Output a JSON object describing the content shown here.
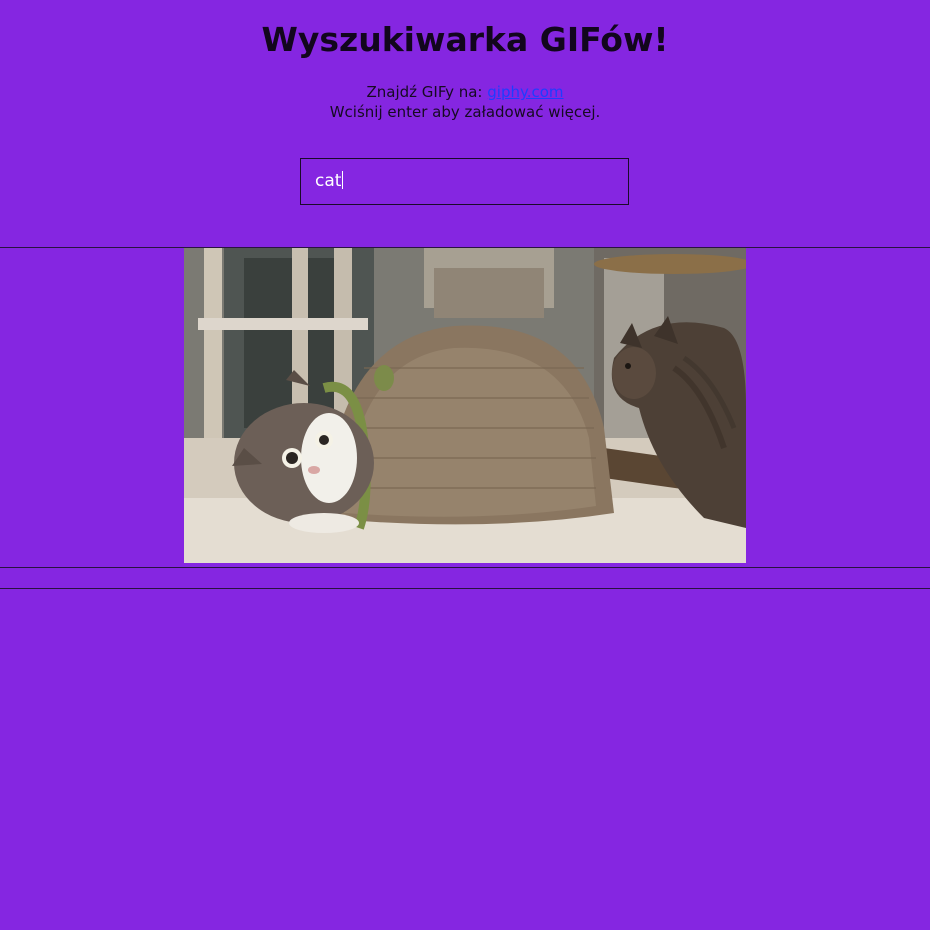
{
  "header": {
    "title": "Wyszukiwarka GIFów!",
    "find_prefix": "Znajdź GIFy na:",
    "link_text": "giphy.com",
    "hint": "Wciśnij enter aby załadować więcej."
  },
  "search": {
    "value": "cat"
  },
  "results": [
    {
      "alt": "cat peeking out of a cardboard tunnel"
    }
  ],
  "colors": {
    "background": "#8526e1",
    "link": "#1f3cff",
    "input_text": "#ffffff"
  }
}
